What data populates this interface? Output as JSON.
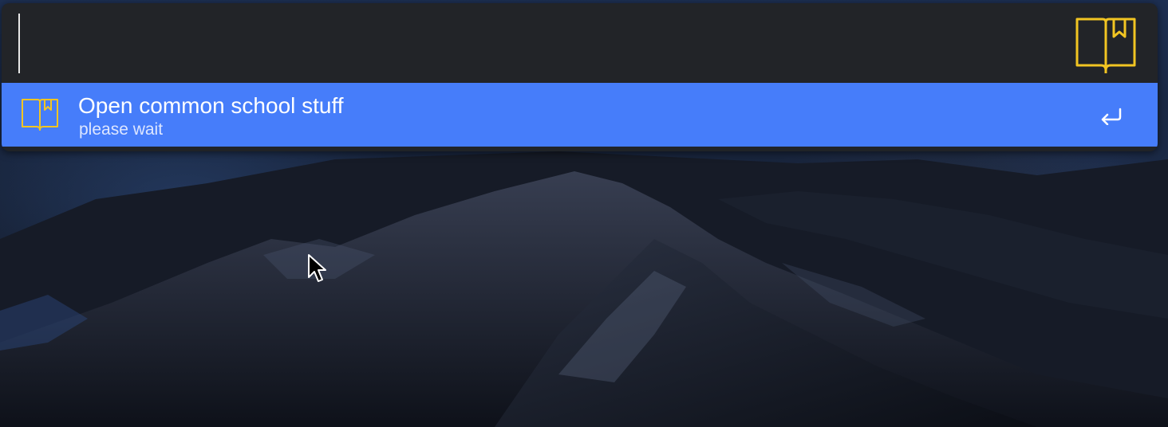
{
  "search": {
    "value": "",
    "placeholder": ""
  },
  "header": {
    "app_icon": "book-bookmark-icon"
  },
  "results": [
    {
      "title": "Open common school stuff",
      "subtitle": "please wait",
      "icon": "book-bookmark-icon",
      "action_icon": "enter-return-icon",
      "selected": true
    }
  ],
  "colors": {
    "panel_bg": "#222428",
    "selection": "#467dfa",
    "icon_accent": "#f2c522",
    "text": "#ffffff"
  }
}
